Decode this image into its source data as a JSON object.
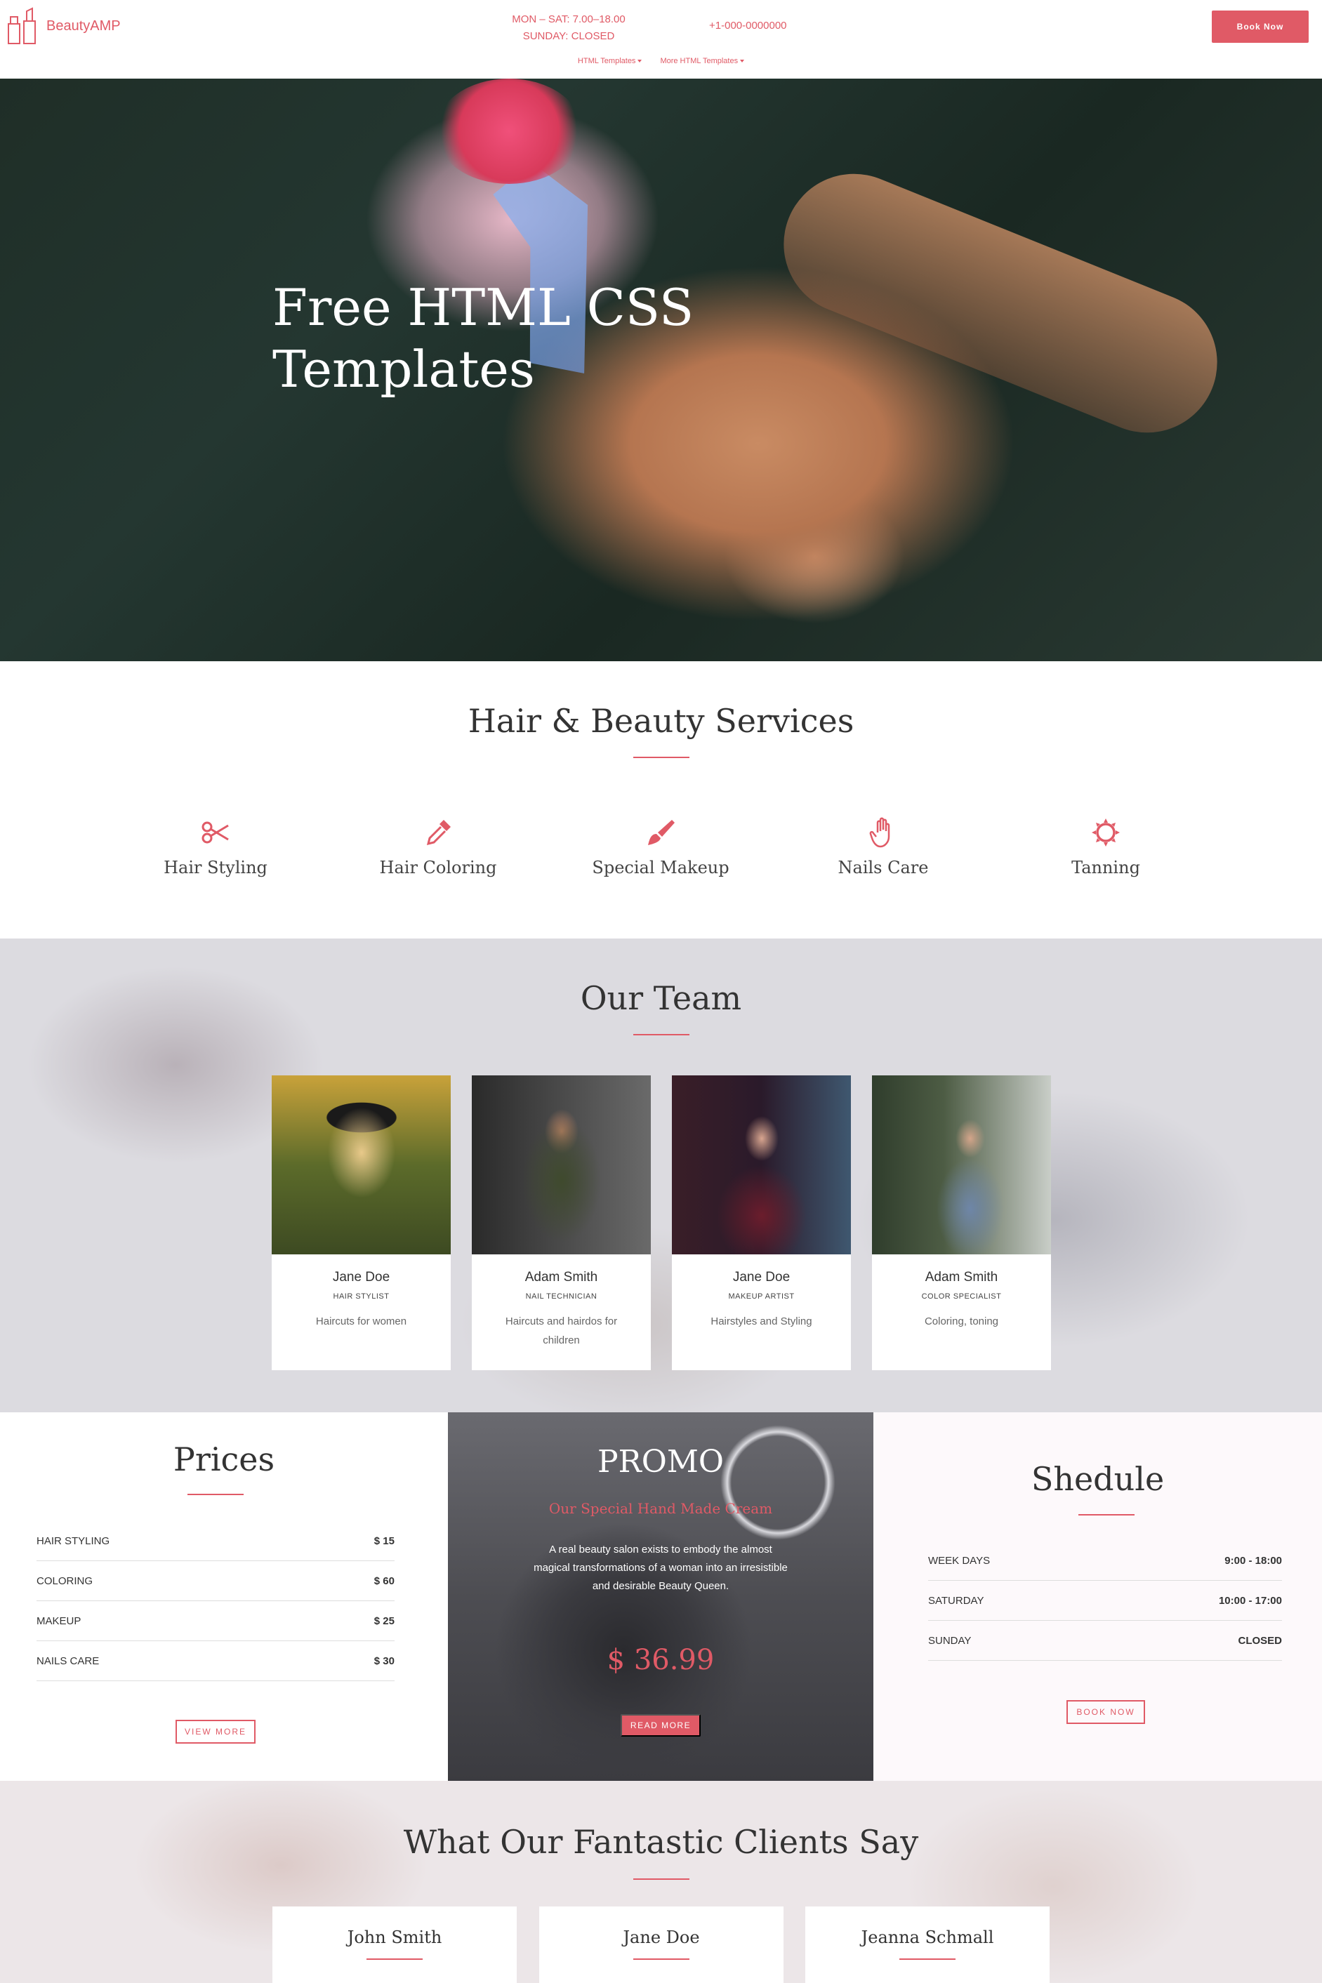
{
  "header": {
    "logo_text": "BeautyAMP",
    "hours_line1": "MON – SAT: 7.00–18.00",
    "hours_line2": "SUNDAY: CLOSED",
    "phone": "+1-000-0000000",
    "book_now": "Book Now",
    "nav": [
      "HTML Templates",
      "More HTML Templates"
    ]
  },
  "hero": {
    "title_line1": "Free HTML CSS",
    "title_line2": "Templates"
  },
  "services": {
    "title": "Hair & Beauty Services",
    "items": [
      {
        "label": "Hair Styling",
        "icon": "scissors-icon"
      },
      {
        "label": "Hair Coloring",
        "icon": "dropper-icon"
      },
      {
        "label": "Special Makeup",
        "icon": "brush-icon"
      },
      {
        "label": "Nails Care",
        "icon": "hand-icon"
      },
      {
        "label": "Tanning",
        "icon": "sun-icon"
      }
    ]
  },
  "team": {
    "title": "Our Team",
    "members": [
      {
        "name": "Jane Doe",
        "role": "HAIR STYLIST",
        "desc": "Haircuts for women"
      },
      {
        "name": "Adam Smith",
        "role": "NAIL TECHNICIAN",
        "desc": "Haircuts and hairdos for children"
      },
      {
        "name": "Jane Doe",
        "role": "MAKEUP ARTIST",
        "desc": "Hairstyles and Styling"
      },
      {
        "name": "Adam Smith",
        "role": "COLOR SPECIALIST",
        "desc": "Coloring, toning"
      }
    ]
  },
  "prices": {
    "title": "Prices",
    "rows": [
      {
        "label": "HAIR STYLING",
        "value": "$ 15"
      },
      {
        "label": "COLORING",
        "value": "$ 60"
      },
      {
        "label": "MAKEUP",
        "value": "$ 25"
      },
      {
        "label": "NAILS CARE",
        "value": "$ 30"
      }
    ],
    "button": "VIEW MORE"
  },
  "promo": {
    "title": "PROMO",
    "subtitle": "Our Special Hand Made Cream",
    "description": "A real beauty salon exists to embody the almost magical transformations of a woman into an irresistible and desirable Beauty Queen.",
    "price": "$ 36.99",
    "button": "READ MORE"
  },
  "schedule": {
    "title": "Shedule",
    "rows": [
      {
        "label": "WEEK DAYS",
        "value": "9:00 - 18:00"
      },
      {
        "label": "SATURDAY",
        "value": "10:00 - 17:00"
      },
      {
        "label": "SUNDAY",
        "value": "CLOSED"
      }
    ],
    "button": "BOOK NOW"
  },
  "testimonials": {
    "title": "What Our Fantastic Clients Say",
    "clients": [
      {
        "name": "John Smith"
      },
      {
        "name": "Jane Doe"
      },
      {
        "name": "Jeanna Schmall"
      }
    ]
  },
  "colors": {
    "accent": "#e05a66",
    "text": "#333333"
  }
}
